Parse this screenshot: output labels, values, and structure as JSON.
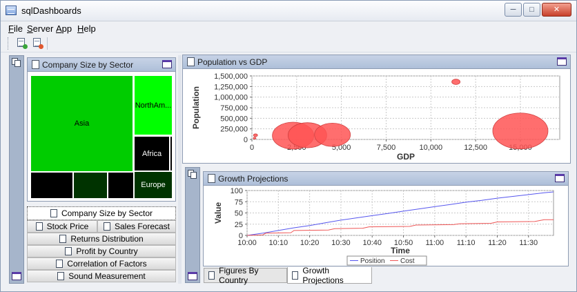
{
  "window": {
    "title": "sqlDashboards"
  },
  "menu": [
    {
      "label": "File"
    },
    {
      "label": "Server"
    },
    {
      "label": "App"
    },
    {
      "label": "Help"
    }
  ],
  "toolbar": {
    "buttons": [
      {
        "icon": "add-document-icon",
        "badge_color": "#3aa63a"
      },
      {
        "icon": "remove-document-icon",
        "badge_color": "#e0572e"
      }
    ]
  },
  "panels": {
    "treemap": {
      "title": "Company Size by Sector",
      "cells": [
        {
          "label": "Asia",
          "color": "#00cc00",
          "text_color": "#000000"
        },
        {
          "label": "NorthAm...",
          "color": "#00ff00",
          "text_color": "#000000"
        },
        {
          "label": "Africa",
          "color": "#000000",
          "text_color": "#ffffff"
        },
        {
          "label": "",
          "color": "#000000",
          "text_color": "#ffffff"
        },
        {
          "label": "Europe",
          "color": "#003300",
          "text_color": "#ffffff"
        },
        {
          "label": "",
          "color": "#000000",
          "text_color": "#ffffff"
        },
        {
          "label": "",
          "color": "#003300",
          "text_color": "#ffffff"
        },
        {
          "label": "",
          "color": "#000000",
          "text_color": "#ffffff"
        }
      ]
    },
    "scatter": {
      "title": "Population vs GDP"
    },
    "growth": {
      "title": "Growth Projections"
    }
  },
  "nav": {
    "active": "Company Size by Sector",
    "row_split": [
      "Stock Price",
      "Sales Forecast"
    ],
    "rows": [
      "Returns Distribution",
      "Profit by Country",
      "Correlation of Factors",
      "Sound Measurement"
    ]
  },
  "tabs": [
    {
      "label": "Figures By Country",
      "active": false
    },
    {
      "label": "Growth Projections",
      "active": true
    }
  ],
  "chart_data": [
    {
      "type": "scatter",
      "xlabel": "GDP",
      "ylabel": "Population",
      "xlim": [
        0,
        17200
      ],
      "ylim": [
        0,
        1500000
      ],
      "xticks": [
        0,
        2500,
        5000,
        7500,
        10000,
        12500,
        15000
      ],
      "yticks": [
        0,
        250000,
        500000,
        750000,
        1000000,
        1250000,
        1500000
      ],
      "xtick_labels": [
        "0",
        "2,500",
        "5,000",
        "7,500",
        "10,000",
        "12,500",
        "15,000"
      ],
      "ytick_labels": [
        "0",
        "250,000",
        "500,000",
        "750,000",
        "1,000,000",
        "1,250,000",
        "1,500,000"
      ],
      "grid": true,
      "color": "#ff5555",
      "points": [
        {
          "x": 200,
          "y": 100000,
          "size": 3
        },
        {
          "x": 150,
          "y": 30000,
          "size": 2
        },
        {
          "x": 2300,
          "y": 90000,
          "size": 30
        },
        {
          "x": 3100,
          "y": 100000,
          "size": 28
        },
        {
          "x": 4500,
          "y": 110000,
          "size": 26
        },
        {
          "x": 11400,
          "y": 1360000,
          "size": 6
        },
        {
          "x": 15000,
          "y": 200000,
          "size": 40
        }
      ]
    },
    {
      "type": "line",
      "xlabel": "Time",
      "ylabel": "Value",
      "ylim": [
        0,
        100
      ],
      "yticks": [
        0,
        25,
        50,
        75,
        100
      ],
      "ytick_labels": [
        "0",
        "25",
        "50",
        "75",
        "100"
      ],
      "x_minutes": [
        0,
        10,
        20,
        30,
        40,
        50,
        60,
        70,
        80,
        90
      ],
      "xtick_labels": [
        "10:00",
        "10:10",
        "10:20",
        "10:30",
        "10:40",
        "10:50",
        "11:00",
        "11:10",
        "11:20",
        "11:30"
      ],
      "xlim_minutes": [
        0,
        98
      ],
      "grid": true,
      "legend": "bottom",
      "series": [
        {
          "name": "Position",
          "color": "#5555ee",
          "points": [
            [
              0,
              0
            ],
            [
              5,
              5
            ],
            [
              10,
              11
            ],
            [
              15,
              17
            ],
            [
              20,
              22
            ],
            [
              25,
              28
            ],
            [
              30,
              34
            ],
            [
              35,
              39
            ],
            [
              40,
              44
            ],
            [
              45,
              49
            ],
            [
              50,
              54
            ],
            [
              55,
              59
            ],
            [
              60,
              64
            ],
            [
              65,
              69
            ],
            [
              70,
              74
            ],
            [
              75,
              78
            ],
            [
              80,
              83
            ],
            [
              85,
              87
            ],
            [
              90,
              91
            ],
            [
              95,
              95
            ],
            [
              98,
              97
            ]
          ]
        },
        {
          "name": "Cost",
          "color": "#ee5555",
          "points": [
            [
              0,
              0
            ],
            [
              5,
              1
            ],
            [
              6,
              5
            ],
            [
              14,
              6
            ],
            [
              15,
              11
            ],
            [
              26,
              12
            ],
            [
              28,
              15
            ],
            [
              37,
              16
            ],
            [
              39,
              19
            ],
            [
              52,
              20
            ],
            [
              54,
              23
            ],
            [
              66,
              24
            ],
            [
              68,
              26
            ],
            [
              78,
              27
            ],
            [
              80,
              30
            ],
            [
              92,
              31
            ],
            [
              95,
              35
            ],
            [
              98,
              35
            ]
          ]
        }
      ]
    }
  ]
}
